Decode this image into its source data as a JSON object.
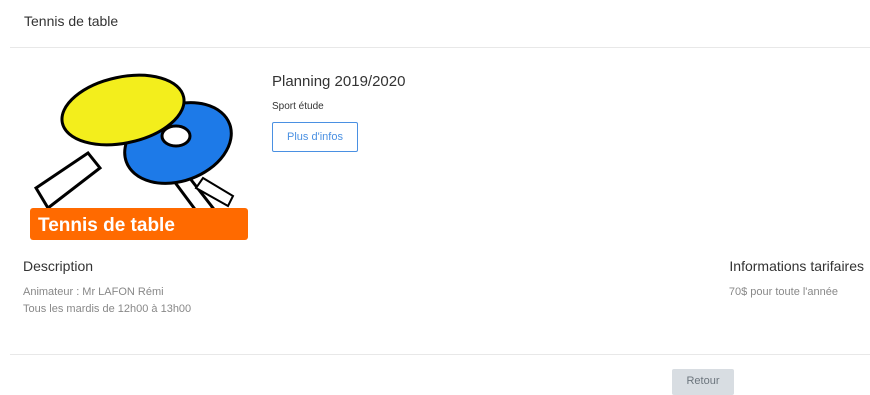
{
  "header": {
    "title": "Tennis de table"
  },
  "logo": {
    "banner_text": "Tennis de table",
    "colors": {
      "paddle_yellow": "#f3ee1c",
      "paddle_blue": "#1d7ae8",
      "banner_orange": "#ff6a00"
    }
  },
  "activity": {
    "title": "Planning 2019/2020",
    "subtitle": "Sport étude",
    "more_button": "Plus d'infos"
  },
  "description": {
    "heading": "Description",
    "lines": [
      "Animateur : Mr LAFON Rémi",
      "Tous les mardis de 12h00 à 13h00"
    ]
  },
  "pricing": {
    "heading": "Informations tarifaires",
    "text": "70$ pour toute l'année"
  },
  "footer": {
    "back_button": "Retour"
  },
  "colors": {
    "accent": "#4a90e2",
    "muted_text": "#888888"
  }
}
